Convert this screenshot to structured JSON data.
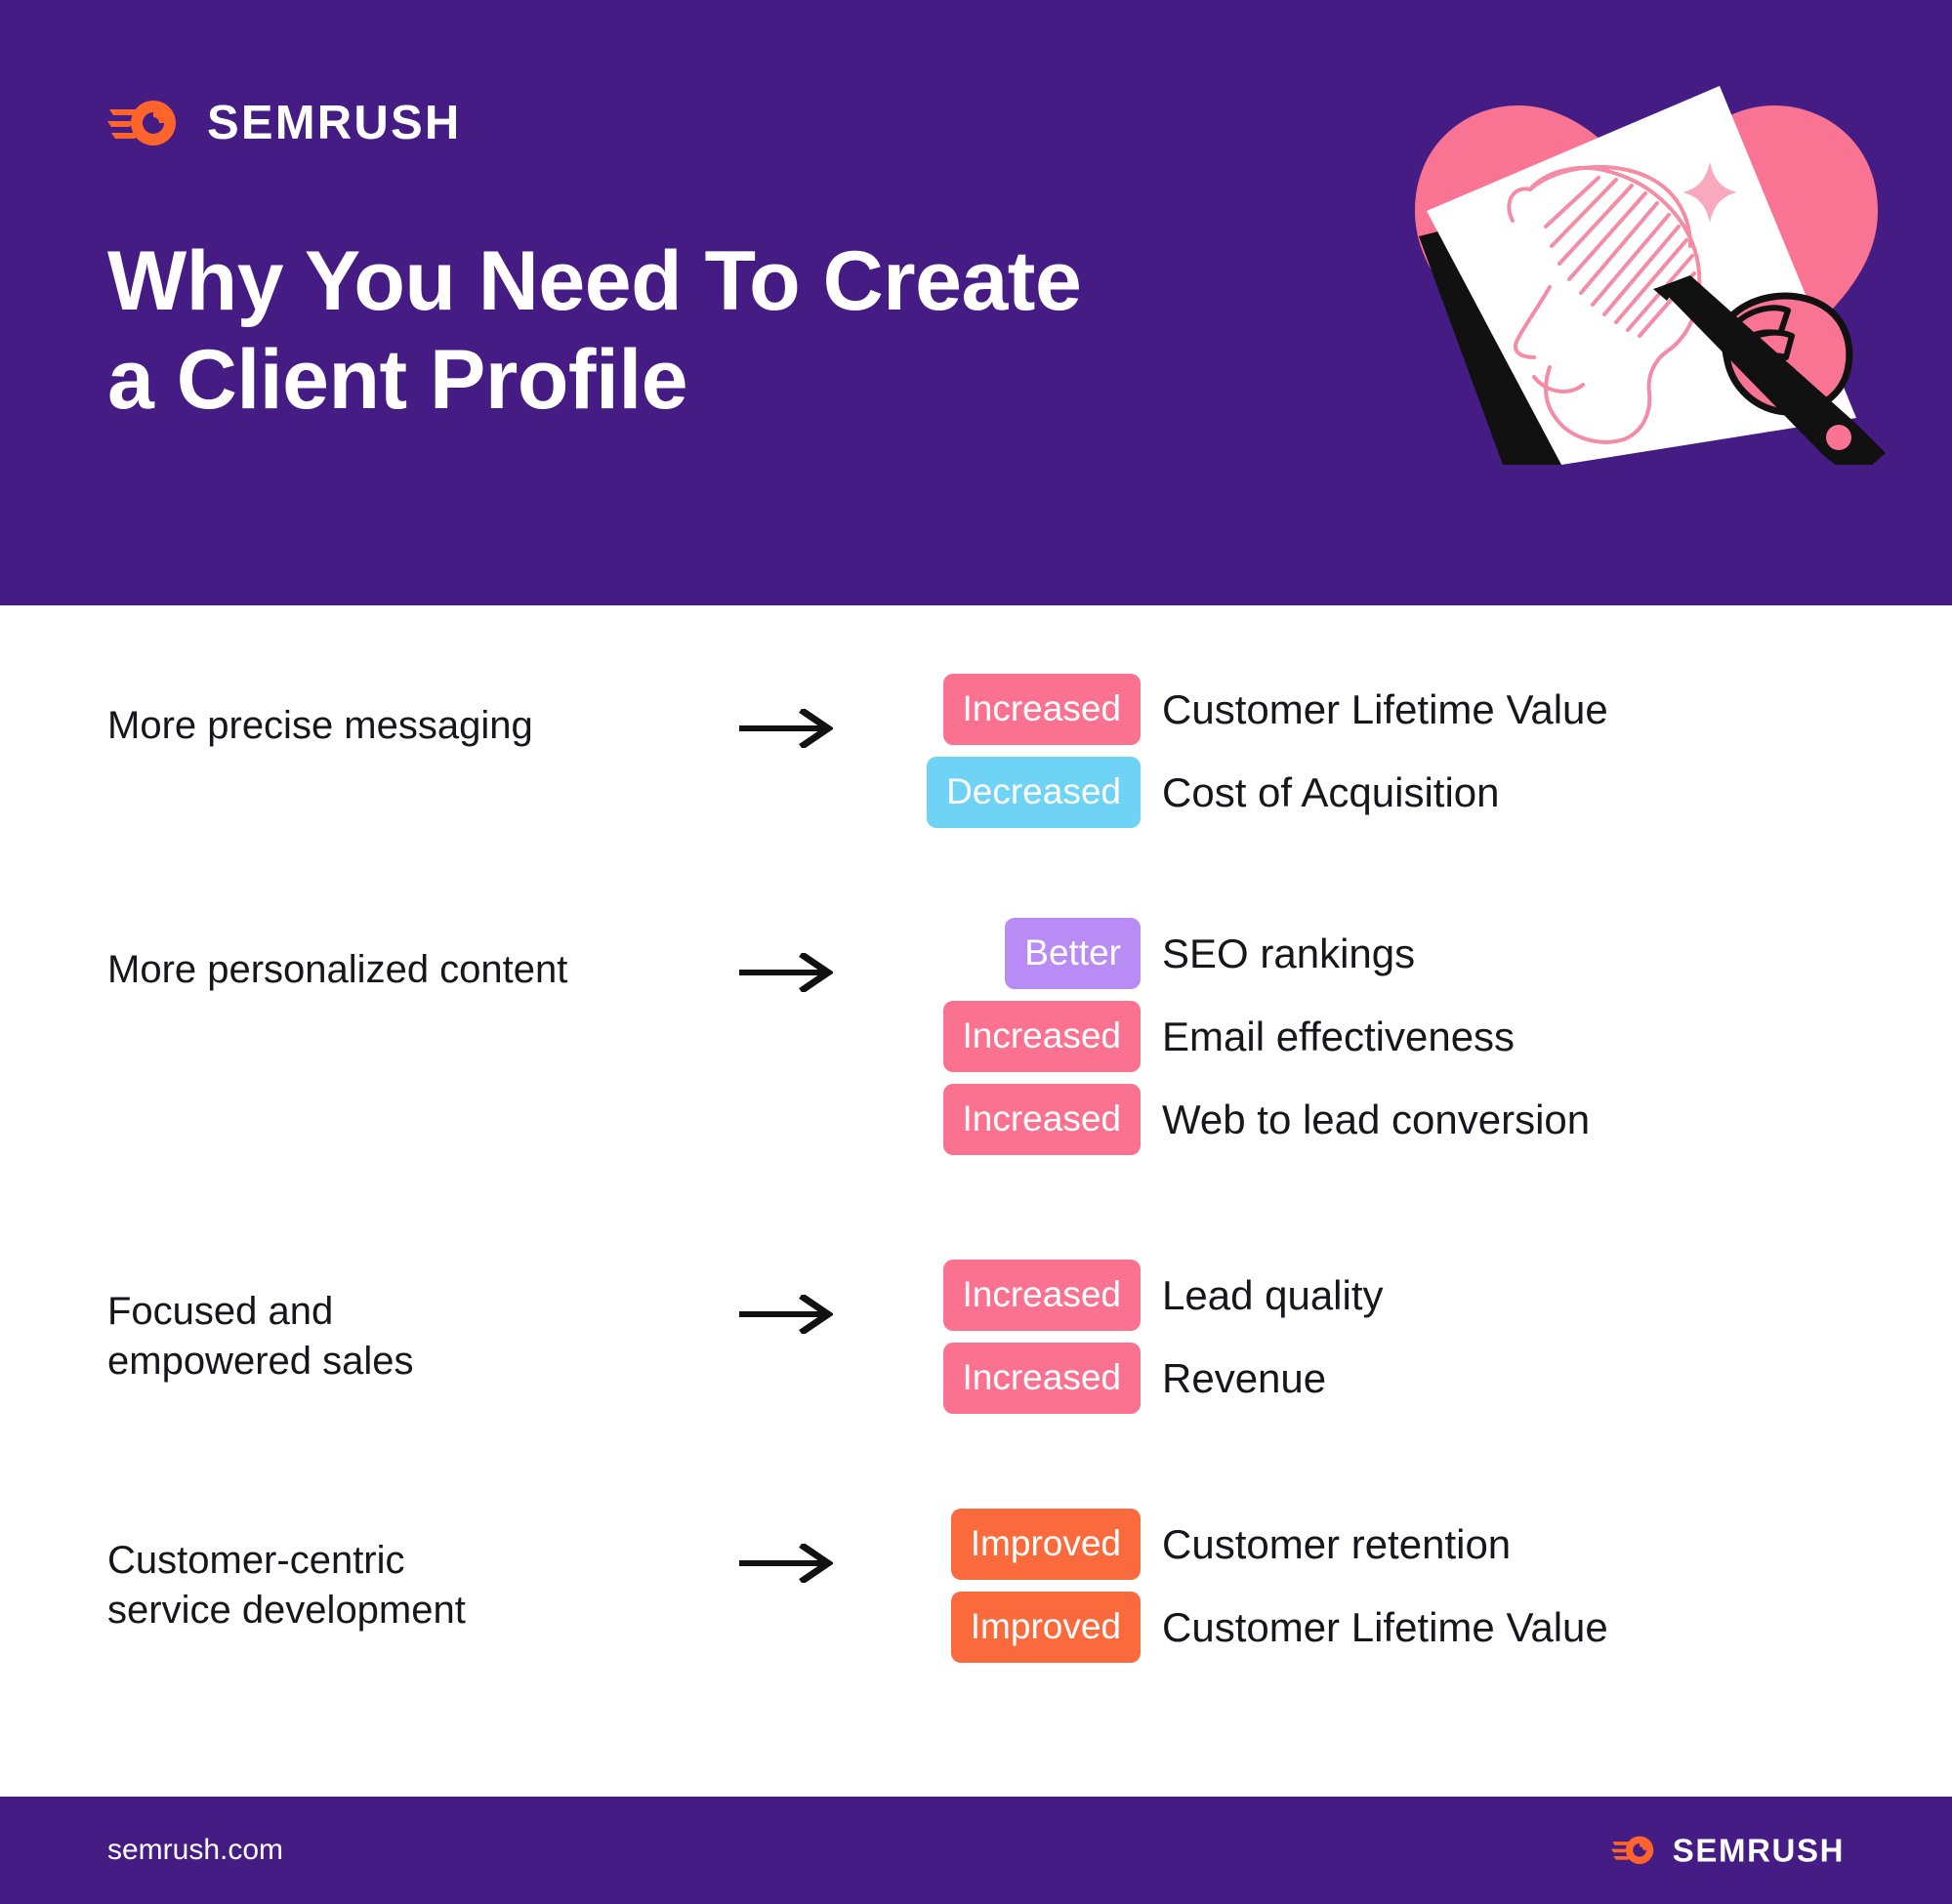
{
  "header": {
    "brand": "SEMRUSH",
    "brand_icon": "semrush-comet-logo-icon",
    "title_line1": "Why You Need To Create",
    "title_line2": "a Client Profile",
    "background_color": "#451C84",
    "illustration": {
      "name": "hand-drawing-client-profile-illustration",
      "heart_color": "#F97393",
      "paper_color": "#FFFFFF",
      "line_color": "#F58CA6",
      "pen_color": "#111111",
      "sparkle_icon": "sparkle-star-icon"
    }
  },
  "main": {
    "groups": [
      {
        "cause_lines": [
          "More precise messaging"
        ],
        "arrow_icon": "arrow-right-icon",
        "effects": [
          {
            "badge": "Increased",
            "badge_color": "#FA7290",
            "tone": "pink",
            "label": "Customer Lifetime Value"
          },
          {
            "badge": "Decreased",
            "badge_color": "#6ED3F5",
            "tone": "blue",
            "label": "Cost of Acquisition"
          }
        ]
      },
      {
        "cause_lines": [
          "More personalized content"
        ],
        "arrow_icon": "arrow-right-icon",
        "effects": [
          {
            "badge": "Better",
            "badge_color": "#B98CF5",
            "tone": "purple",
            "label": "SEO rankings"
          },
          {
            "badge": "Increased",
            "badge_color": "#FA7290",
            "tone": "pink",
            "label": "Email effectiveness"
          },
          {
            "badge": "Increased",
            "badge_color": "#FA7290",
            "tone": "pink",
            "label": "Web to lead conversion"
          }
        ]
      },
      {
        "cause_lines": [
          "Focused and",
          "empowered sales"
        ],
        "arrow_icon": "arrow-right-icon",
        "effects": [
          {
            "badge": "Increased",
            "badge_color": "#FA7290",
            "tone": "pink",
            "label": "Lead quality"
          },
          {
            "badge": "Increased",
            "badge_color": "#FA7290",
            "tone": "pink",
            "label": "Revenue"
          }
        ]
      },
      {
        "cause_lines": [
          "Customer-centric",
          "service development"
        ],
        "arrow_icon": "arrow-right-icon",
        "effects": [
          {
            "badge": "Improved",
            "badge_color": "#FB6A3C",
            "tone": "orange",
            "label": "Customer retention"
          },
          {
            "badge": "Improved",
            "badge_color": "#FB6A3C",
            "tone": "orange",
            "label": "Customer Lifetime Value"
          }
        ]
      }
    ]
  },
  "footer": {
    "url": "semrush.com",
    "brand": "SEMRUSH",
    "brand_icon": "semrush-comet-logo-icon",
    "background_color": "#451C84"
  }
}
